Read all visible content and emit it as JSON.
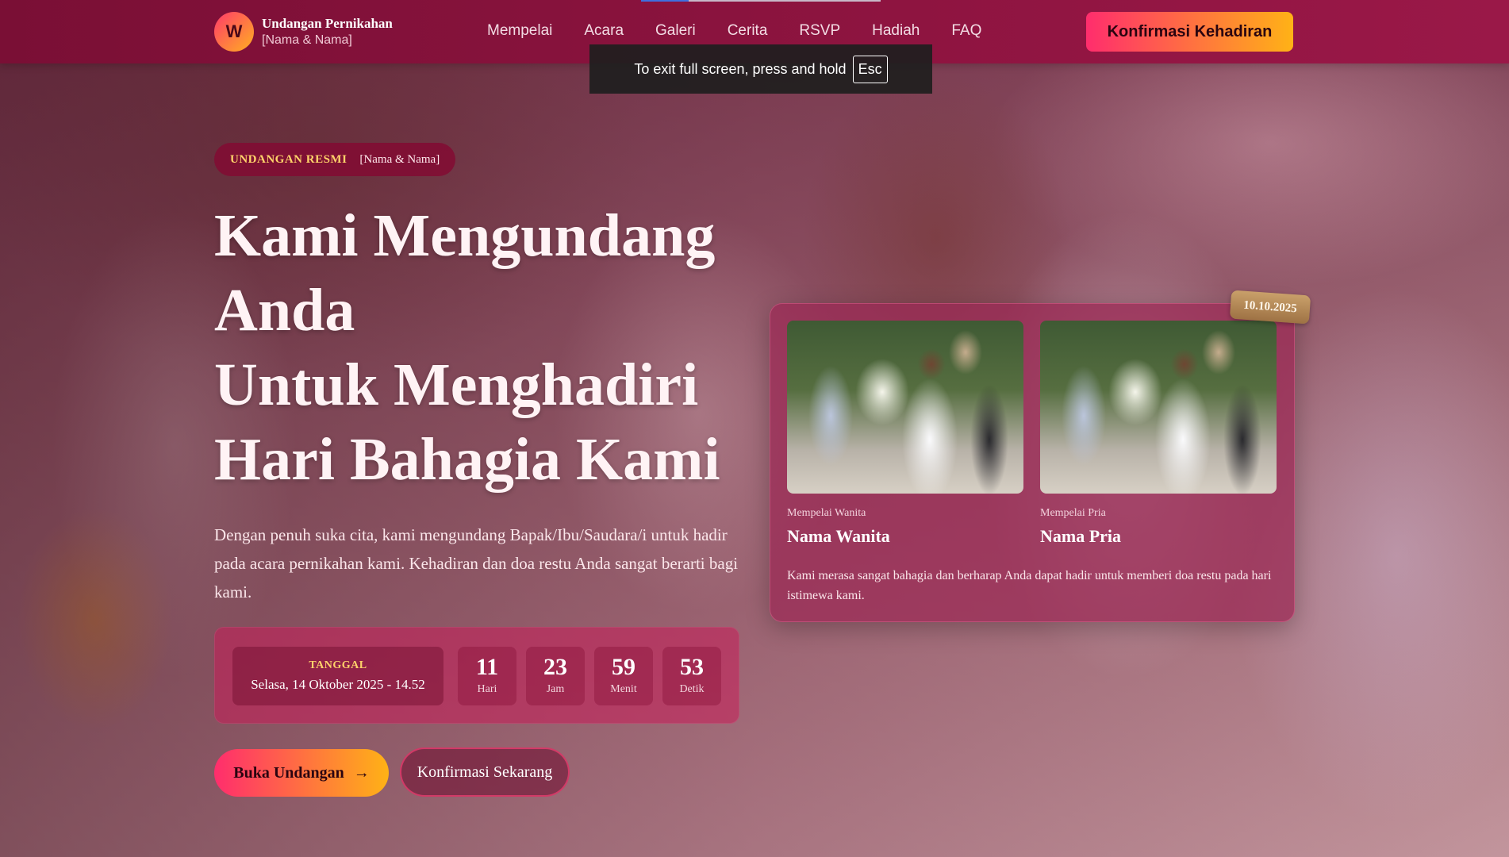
{
  "header": {
    "logo_letter": "W",
    "logo_title": "Undangan Pernikahan",
    "logo_subtitle": "[Nama & Nama]",
    "nav": [
      "Mempelai",
      "Acara",
      "Galeri",
      "Cerita",
      "RSVP",
      "Hadiah",
      "FAQ"
    ],
    "cta_label": "Konfirmasi Kehadiran"
  },
  "fullscreen_toast": {
    "message": "To exit full screen, press and hold",
    "key": "Esc"
  },
  "hero": {
    "badge_main": "UNDANGAN RESMI",
    "badge_sub": "[Nama & Nama]",
    "title_lines": [
      "Kami Mengundang",
      "Anda",
      "Untuk Menghadiri",
      "Hari Bahagia Kami"
    ],
    "description": "Dengan penuh suka cita, kami mengundang Bapak/Ibu/Saudara/i untuk hadir pada acara pernikahan kami. Kehadiran dan doa restu Anda sangat berarti bagi kami.",
    "countdown": {
      "date_label": "TANGGAL",
      "date_value": "Selasa, 14 Oktober 2025 - 14.52",
      "units": [
        {
          "value": "11",
          "label": "Hari"
        },
        {
          "value": "23",
          "label": "Jam"
        },
        {
          "value": "59",
          "label": "Menit"
        },
        {
          "value": "53",
          "label": "Detik"
        }
      ]
    },
    "primary_button": "Buka Undangan",
    "primary_arrow": "→",
    "secondary_button": "Konfirmasi Sekarang"
  },
  "couple_card": {
    "date_tag": "10.10.2025",
    "bride_label": "Mempelai Wanita",
    "bride_name": "Nama Wanita",
    "groom_label": "Mempelai Pria",
    "groom_name": "Nama Pria",
    "message": "Kami merasa sangat bahagia dan berharap Anda dapat hadir untuk memberi doa restu pada hari istimewa kami."
  },
  "colors": {
    "header_bg": "#8e1440",
    "accent_gradient_start": "#ff2d6d",
    "accent_gradient_end": "#ffb216",
    "gold_text": "#ffd36a"
  }
}
